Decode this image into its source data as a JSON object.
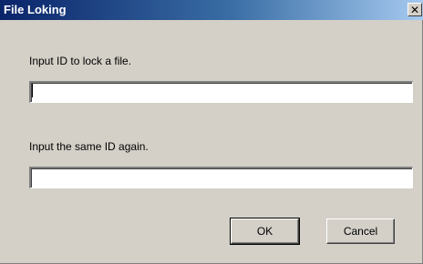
{
  "window": {
    "title": "File Loking",
    "close_icon": "close-icon"
  },
  "form": {
    "id_label": "Input ID to lock a file.",
    "id_value": "",
    "confirm_label": "Input the same ID again.",
    "confirm_value": ""
  },
  "buttons": {
    "ok_label": "OK",
    "cancel_label": "Cancel"
  },
  "colors": {
    "dialog_background": "#d4d0c8",
    "titlebar_start": "#0a246a",
    "titlebar_end": "#a6caf0"
  }
}
